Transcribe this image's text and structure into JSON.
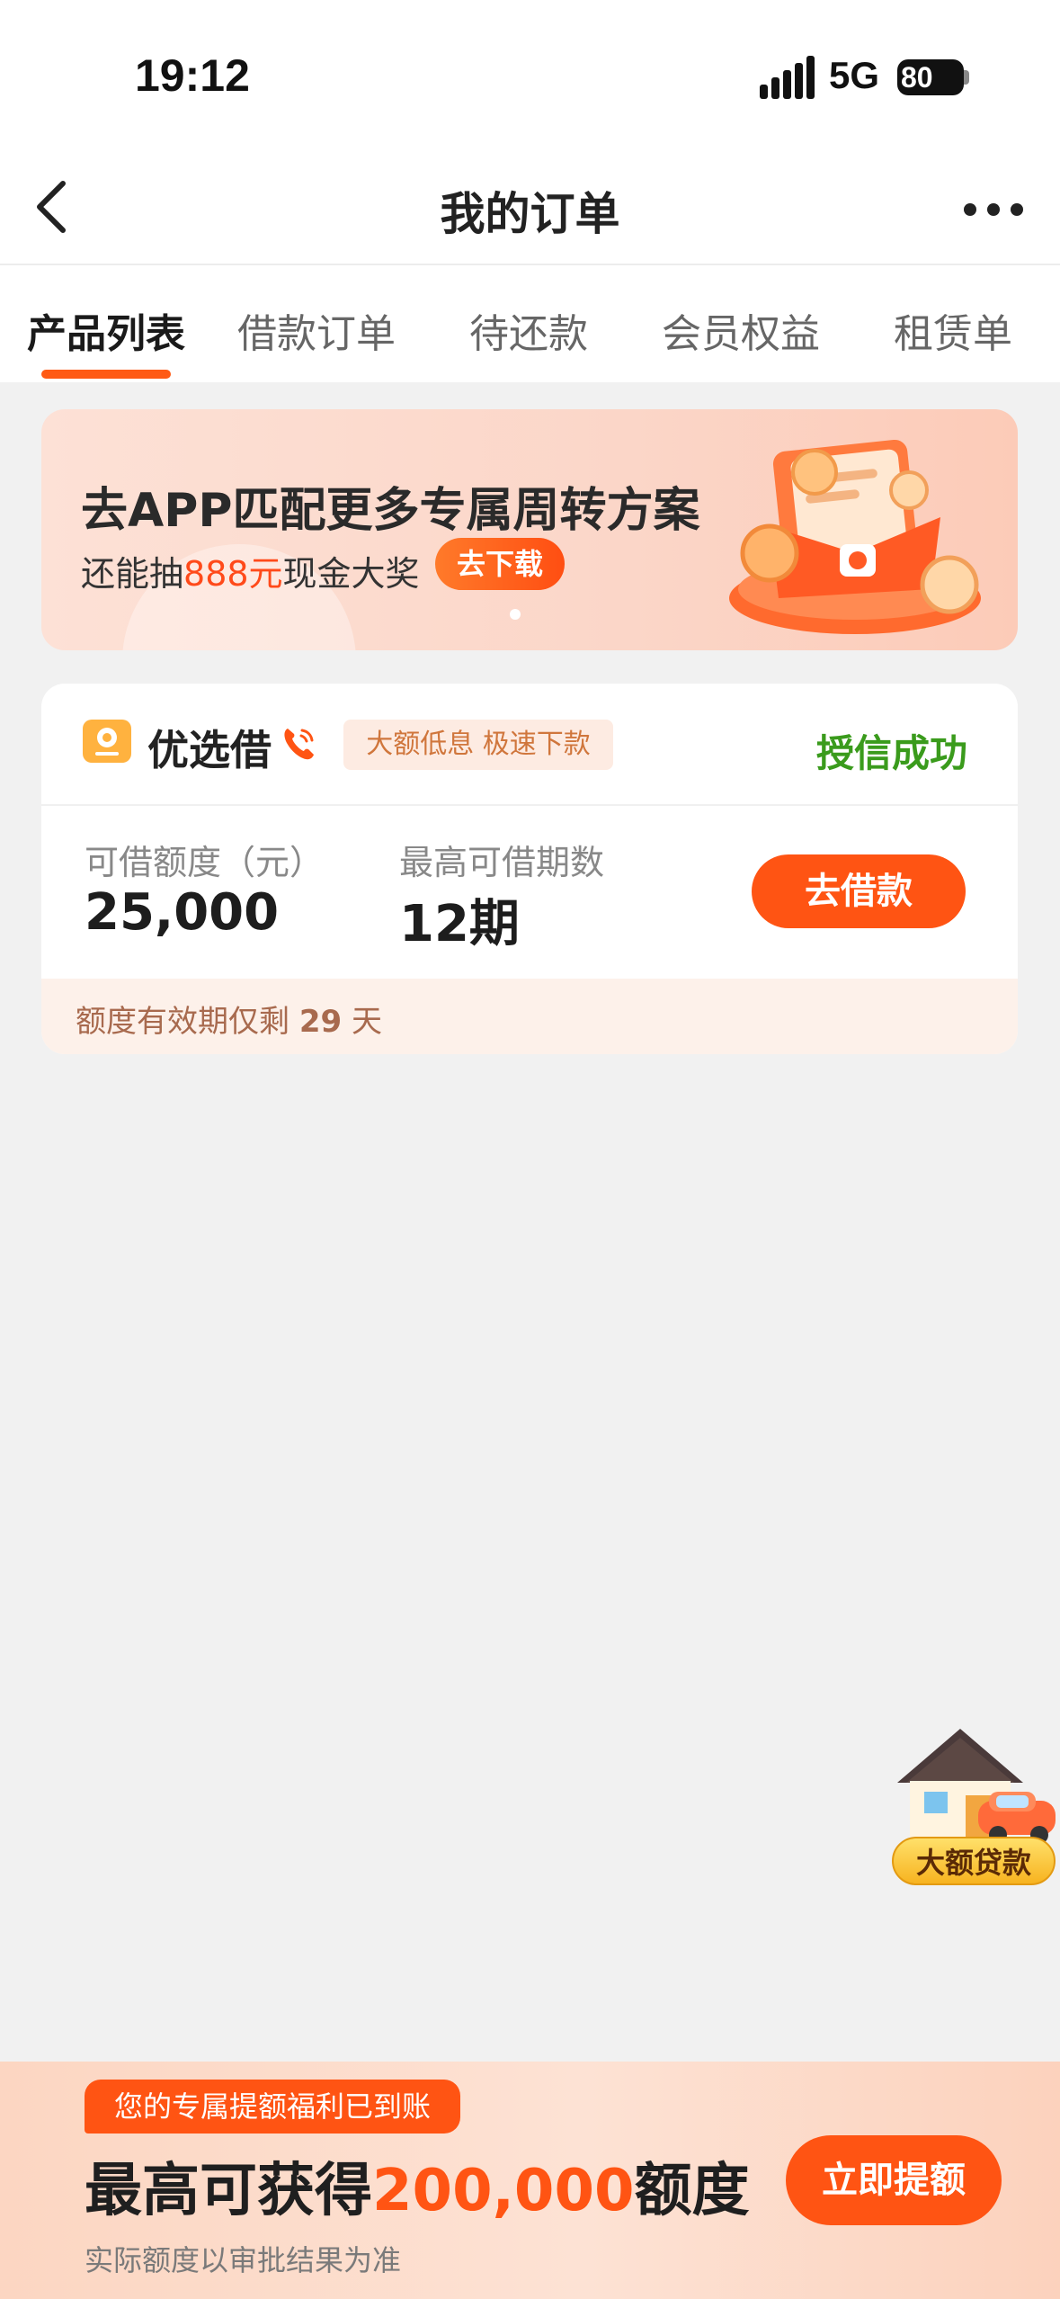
{
  "status_bar": {
    "time": "19:12",
    "network": "5G",
    "battery": "80"
  },
  "nav": {
    "title": "我的订单"
  },
  "tabs": [
    {
      "label": "产品列表"
    },
    {
      "label": "借款订单"
    },
    {
      "label": "待还款"
    },
    {
      "label": "会员权益"
    },
    {
      "label": "租赁单"
    }
  ],
  "banner": {
    "title": "去APP匹配更多专属周转方案",
    "sub_prefix": "还能抽",
    "sub_highlight": "888元",
    "sub_suffix": "现金大奖",
    "button": "去下载"
  },
  "product": {
    "name": "优选借",
    "tag": "大额低息 极速下款",
    "status": "授信成功",
    "amount_label": "可借额度（元）",
    "amount_value": "25,000",
    "period_label": "最高可借期数",
    "period_value": "12期",
    "borrow_button": "去借款",
    "validity_prefix": "额度有效期仅剩",
    "validity_days": "29",
    "validity_suffix": "天"
  },
  "float_loan": {
    "label": "大额贷款"
  },
  "promo": {
    "tag": "您的专属提额福利已到账",
    "main_prefix": "最高可获得",
    "main_number": "200,000",
    "main_suffix": "额度",
    "note": "实际额度以审批结果为准",
    "button": "立即提额"
  },
  "colors": {
    "accent": "#ff5413",
    "success": "#3a9b1c"
  }
}
